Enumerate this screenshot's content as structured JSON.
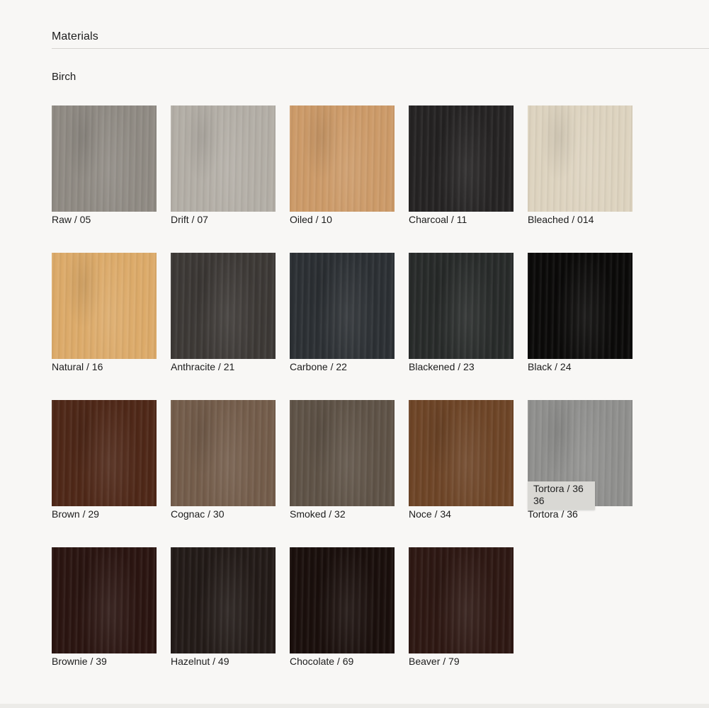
{
  "section": {
    "title": "Materials"
  },
  "subsection": {
    "title": "Birch"
  },
  "swatches": [
    {
      "label": "Raw / 05",
      "color": "#8f8a83"
    },
    {
      "label": "Drift / 07",
      "color": "#b3aea6"
    },
    {
      "label": "Oiled / 10",
      "color": "#cc9a68"
    },
    {
      "label": "Charcoal / 11",
      "color": "#242222"
    },
    {
      "label": "Bleached / 014",
      "color": "#ddd3bf"
    },
    {
      "label": "Natural / 16",
      "color": "#dcaa69"
    },
    {
      "label": "Anthracite / 21",
      "color": "#3c3835"
    },
    {
      "label": "Carbone / 22",
      "color": "#2b2f33"
    },
    {
      "label": "Blackened / 23",
      "color": "#272a29"
    },
    {
      "label": "Black / 24",
      "color": "#0a0908"
    },
    {
      "label": "Brown / 29",
      "color": "#4e2717"
    },
    {
      "label": "Cognac / 30",
      "color": "#735c4a"
    },
    {
      "label": "Smoked / 32",
      "color": "#5e5246"
    },
    {
      "label": "Noce / 34",
      "color": "#6d4426"
    },
    {
      "label": "Tortora / 36",
      "color": "#8f8f8d"
    },
    {
      "label": "Brownie / 39",
      "color": "#2a1410"
    },
    {
      "label": "Hazelnut / 49",
      "color": "#221a17"
    },
    {
      "label": "Chocolate / 69",
      "color": "#190e0b"
    },
    {
      "label": "Beaver / 79",
      "color": "#2d1712"
    }
  ],
  "tooltip": {
    "line1": "Tortora / 36",
    "line2": "36"
  }
}
